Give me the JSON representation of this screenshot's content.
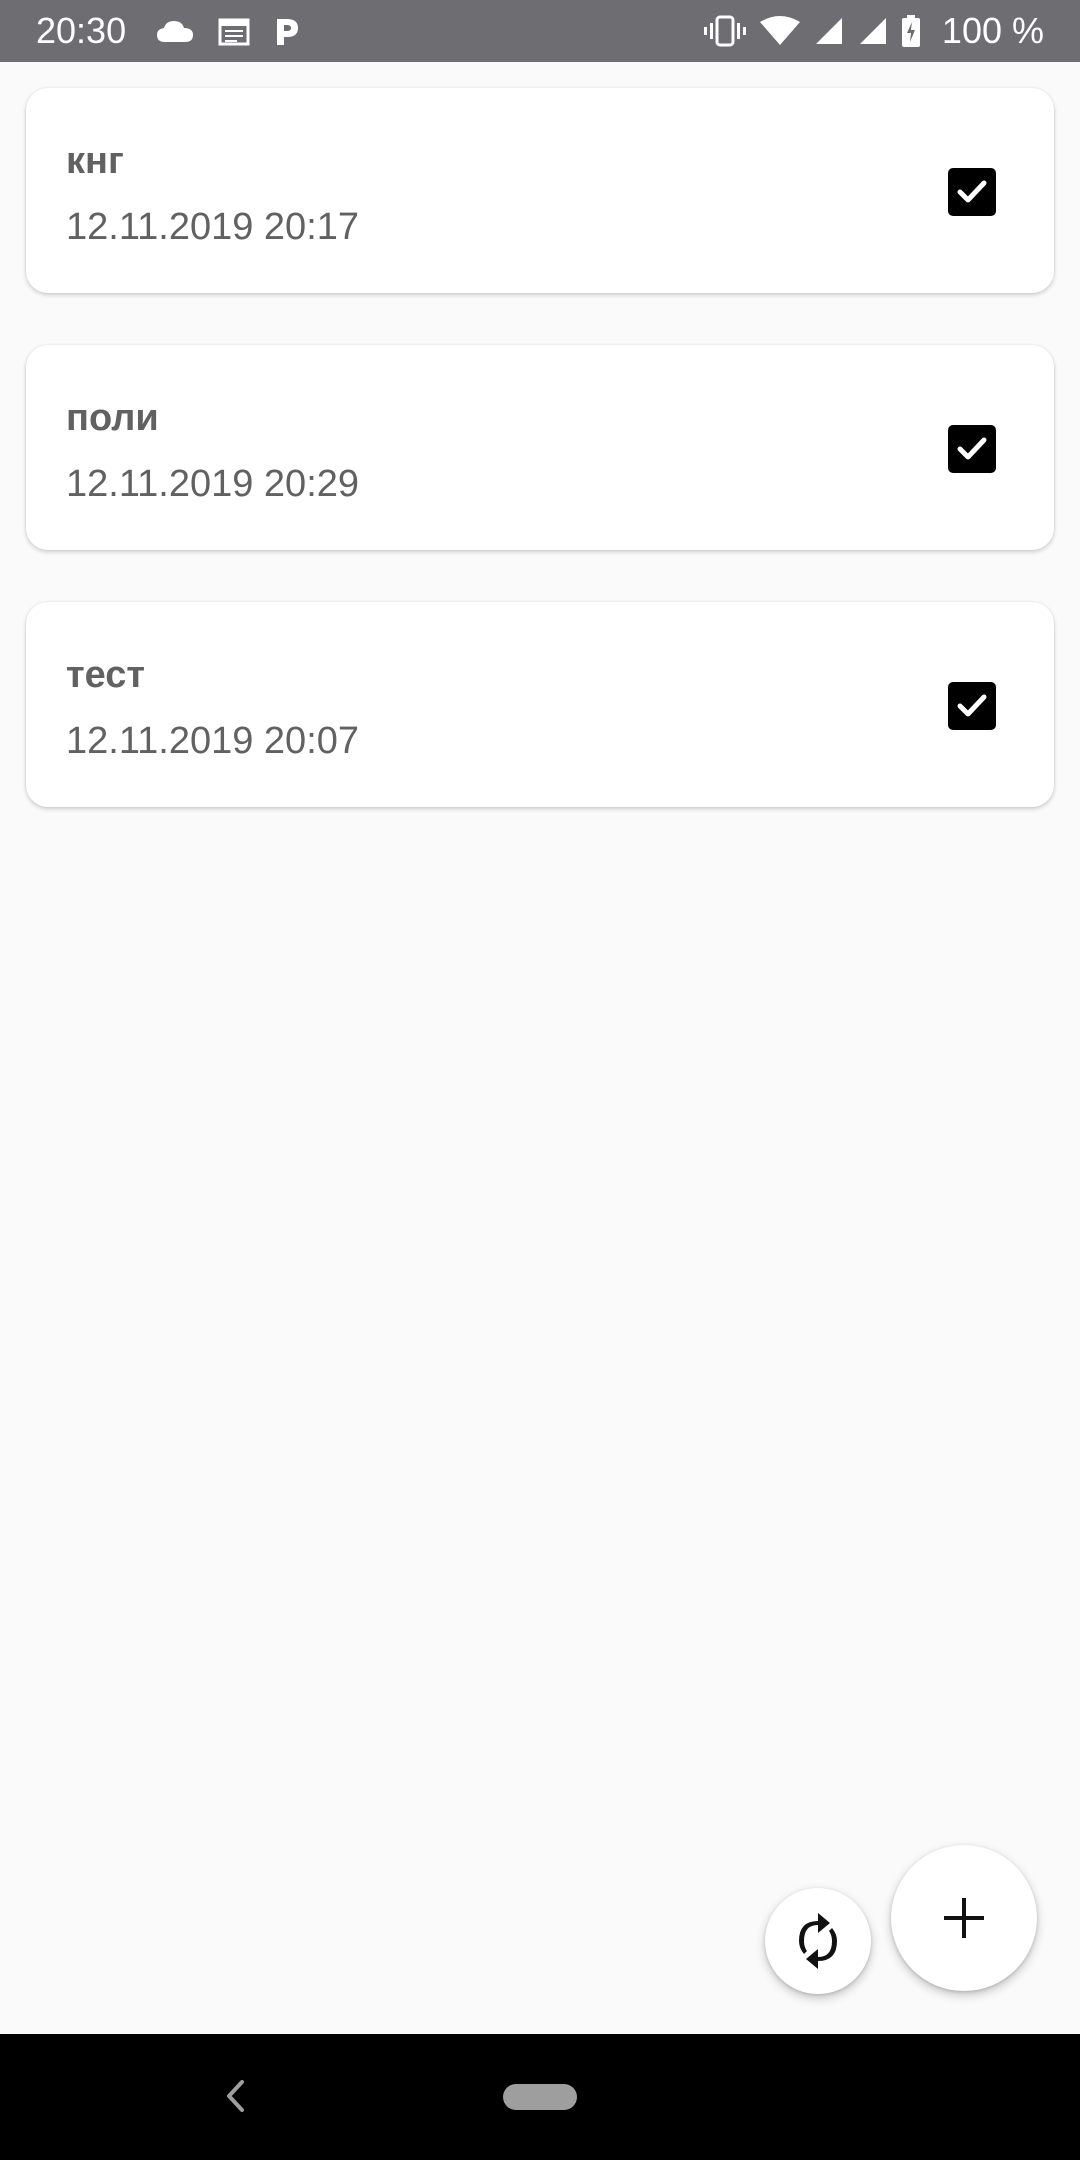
{
  "status_bar": {
    "time": "20:30",
    "battery": "100 %",
    "icons": [
      "cloud-icon",
      "calendar-icon",
      "parking-icon",
      "vibrate-icon",
      "wifi-icon",
      "signal-icon",
      "signal-icon",
      "battery-charging-icon"
    ]
  },
  "items": [
    {
      "title": "кнг",
      "date": "12.11.2019 20:17",
      "checked": true
    },
    {
      "title": "поли",
      "date": "12.11.2019 20:29",
      "checked": true
    },
    {
      "title": "тест",
      "date": "12.11.2019 20:07",
      "checked": true
    }
  ],
  "fabs": {
    "sync_icon": "sync-icon",
    "add_icon": "plus-icon"
  },
  "colors": {
    "status_bar": "#6d6d72",
    "background": "#fafafa",
    "text": "#616161",
    "checkbox": "#000000"
  }
}
